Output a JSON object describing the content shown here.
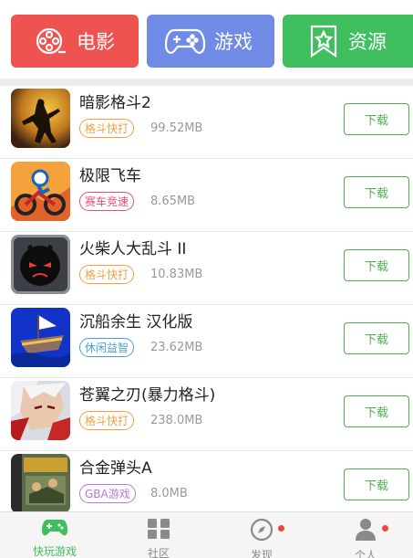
{
  "categories": [
    {
      "label": "电影",
      "color": "#ef5350",
      "icon": "film-reel-icon"
    },
    {
      "label": "游戏",
      "color": "#6f8be6",
      "icon": "gamepad-icon"
    },
    {
      "label": "资源",
      "color": "#3fbf5e",
      "icon": "bookmark-star-icon"
    }
  ],
  "download_label": "下载",
  "apps": [
    {
      "name": "暗影格斗2",
      "tag": "格斗快打",
      "tag_color": "#f0a040",
      "size": "99.52MB"
    },
    {
      "name": "极限飞车",
      "tag": "赛车竞速",
      "tag_color": "#e0507a",
      "size": "8.65MB"
    },
    {
      "name": "火柴人大乱斗 II",
      "tag": "格斗快打",
      "tag_color": "#f0a040",
      "size": "10.83MB"
    },
    {
      "name": "沉船余生  汉化版",
      "tag": "休闲益智",
      "tag_color": "#4a9fd8",
      "size": "23.62MB"
    },
    {
      "name": "苍翼之刃(暴力格斗)",
      "tag": "格斗快打",
      "tag_color": "#f0a040",
      "size": "238.0MB"
    },
    {
      "name": "合金弹头A",
      "tag": "GBA游戏",
      "tag_color": "#b07ad8",
      "size": "8.0MB"
    }
  ],
  "nav": [
    {
      "label": "快玩游戏",
      "icon": "gamepad-icon",
      "active": true,
      "badge": false
    },
    {
      "label": "社区",
      "icon": "grid-icon",
      "active": false,
      "badge": false
    },
    {
      "label": "发现",
      "icon": "compass-icon",
      "active": false,
      "badge": true
    },
    {
      "label": "个人",
      "icon": "person-icon",
      "active": false,
      "badge": true
    }
  ],
  "colors": {
    "accent": "#4caf50",
    "badge": "#f44336"
  }
}
